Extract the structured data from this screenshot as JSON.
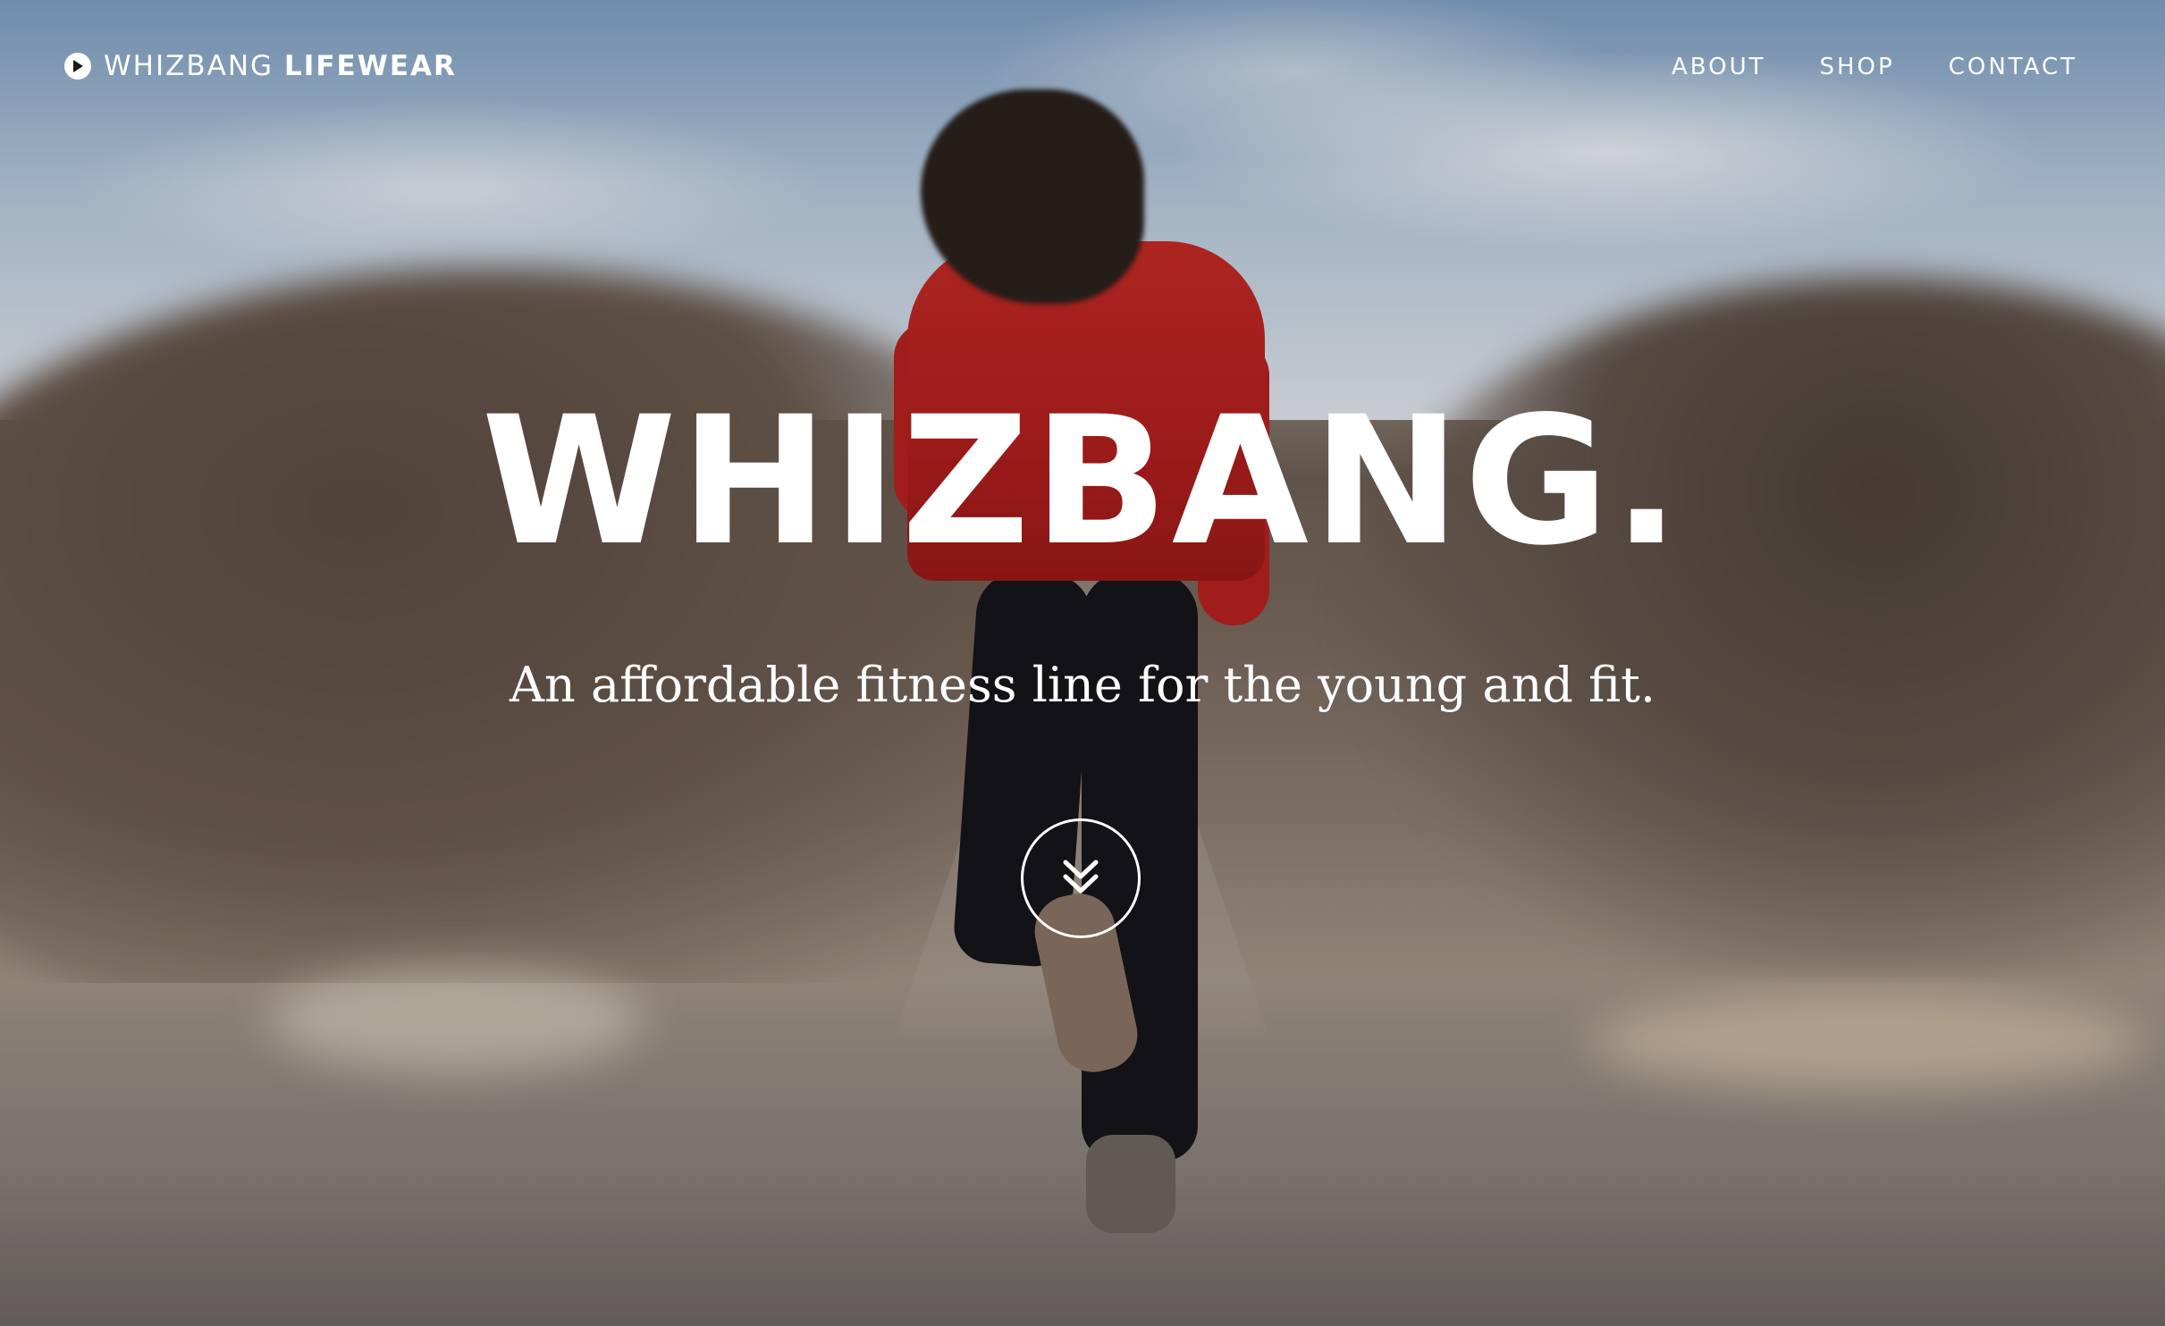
{
  "navbar": {
    "brand": {
      "light": "WHIZBANG",
      "bold": "LIFEWEAR",
      "icon": "play-circle-icon"
    },
    "links": [
      {
        "label": "ABOUT"
      },
      {
        "label": "SHOP"
      },
      {
        "label": "CONTACT"
      }
    ]
  },
  "hero": {
    "headline": "WHIZBANG.",
    "tagline": "An affordable fitness line for the young and fit.",
    "scroll_icon": "double-chevron-down-icon"
  },
  "colors": {
    "text": "#ffffff",
    "jacket": "#c52a26"
  }
}
